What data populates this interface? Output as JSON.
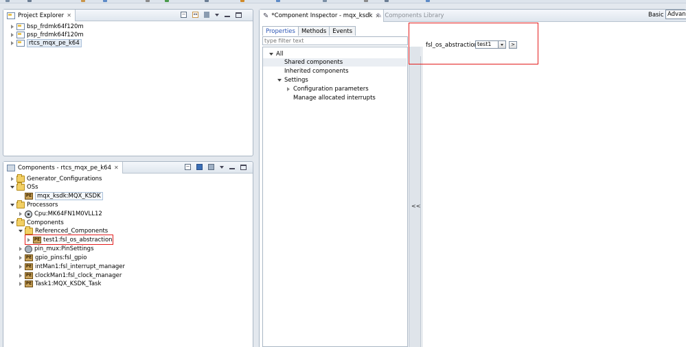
{
  "project_explorer": {
    "title": "Project Explorer",
    "close": "✕",
    "items": [
      {
        "label": "bsp_frdmk64f120m"
      },
      {
        "label": "psp_frdmk64f120m"
      },
      {
        "label": "rtcs_mqx_pe_k64"
      }
    ]
  },
  "components_view": {
    "title": "Components - rtcs_mqx_pe_k64",
    "close": "✕",
    "items": [
      {
        "label": "Generator_Configurations"
      },
      {
        "label": "OSs"
      },
      {
        "label": "mqx_ksdk:MQX_KSDK"
      },
      {
        "label": "Processors"
      },
      {
        "label": "Cpu:MK64FN1M0VLL12"
      },
      {
        "label": "Components"
      },
      {
        "label": "Referenced_Components"
      },
      {
        "label": "test1:fsl_os_abstraction"
      },
      {
        "label": "pin_mux:PinSettings"
      },
      {
        "label": "gpio_pins:fsl_gpio"
      },
      {
        "label": "intMan1:fsl_interrupt_manager"
      },
      {
        "label": "clockMan1:fsl_clock_manager"
      },
      {
        "label": "Task1:MQX_KSDK_Task"
      }
    ],
    "pe_badge": "PE"
  },
  "editor": {
    "active_tab": "*Component Inspector - mqx_ksdk",
    "active_close": "✕",
    "inactive_tab": "Components Library",
    "mode_label": "Basic",
    "mode_value": "Advanced"
  },
  "inspector": {
    "tabs": [
      "Properties",
      "Methods",
      "Events"
    ],
    "filter_placeholder": "type filter text",
    "tree": [
      {
        "label": "All"
      },
      {
        "label": "Shared components"
      },
      {
        "label": "Inherited components"
      },
      {
        "label": "Settings"
      },
      {
        "label": "Configuration parameters"
      },
      {
        "label": "Manage allocated interrupts"
      }
    ],
    "collapse_label": "<<",
    "property": {
      "label": "fsl_os_abstraction",
      "value": "test1",
      "go": ">"
    }
  }
}
